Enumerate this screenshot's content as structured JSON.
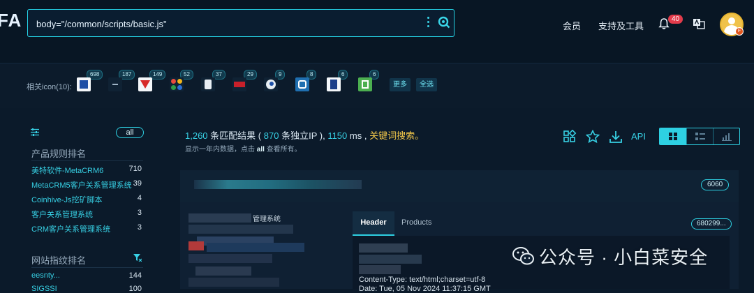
{
  "header": {
    "logo": "FA",
    "search_value": "body=\"/common/scripts/basic.js\"",
    "nav": [
      "会员",
      "支持及工具"
    ],
    "notification_count": "40",
    "avatar_badge": "F"
  },
  "icons": {
    "label": "相关icon(10):",
    "counts": [
      "698",
      "187",
      "149",
      "52",
      "37",
      "29",
      "9",
      "8",
      "6",
      "6"
    ],
    "more_label": "更多",
    "all_label": "全选"
  },
  "sidebar": {
    "all_label": "all",
    "product_title": "产品规则排名",
    "products": [
      {
        "name": "美特软件-MetaCRM6",
        "count": "710"
      },
      {
        "name": "MetaCRM5客户关系管理系统",
        "count": "39"
      },
      {
        "name": "Coinhive-Js挖矿脚本",
        "count": "4"
      },
      {
        "name": "客户关系管理系统",
        "count": "3"
      },
      {
        "name": "CRM客户关系管理系统",
        "count": "3"
      }
    ],
    "site_title": "网站指纹排名",
    "sites": [
      {
        "name": "eesnty...",
        "count": "144"
      },
      {
        "name": "SIGSSI",
        "count": "100"
      }
    ]
  },
  "summary": {
    "total": "1,260",
    "match_text": "条匹配结果 (",
    "ip_count": "870",
    "ip_text": "条独立IP ),",
    "time": "1150",
    "time_unit": "ms ,",
    "keyword_search": "关键词搜索。",
    "sub_prefix": "显示一年内数据，点击",
    "sub_all": "all",
    "sub_suffix": "查看所有。"
  },
  "toolbar": {
    "api_label": "API"
  },
  "result": {
    "port": "6060",
    "title_fragment": "管理系统",
    "tabs": [
      "Header",
      "Products"
    ],
    "id_tag": "680299...",
    "header_lines": [
      "Content-Type: text/html;charset=utf-8",
      "Date: Tue, 05 Nov 2024 11:37:15 GMT"
    ]
  },
  "watermark": "公众号 · 小白菜安全",
  "colors": {
    "accent": "#2ed0e2",
    "highlight": "#f3c84a",
    "badge": "#e23b4b"
  }
}
